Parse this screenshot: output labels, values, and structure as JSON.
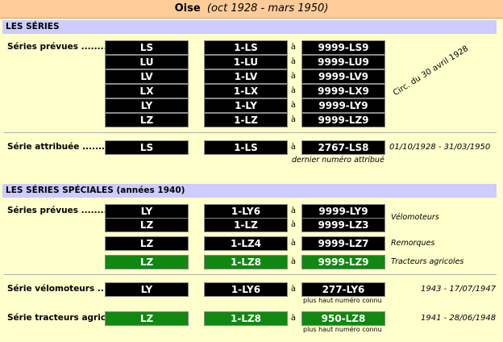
{
  "header": {
    "dept": "Oise",
    "period": "(oct 1928 - mars 1950)"
  },
  "sections": {
    "series": "LES SÉRIES",
    "speciales": "LES SÉRIES SPÉCIALES (années 1940)"
  },
  "labels": {
    "prevues1": "Séries prévues .........",
    "attribuee": "Série attribuée ........",
    "prevues2": "Séries prévues .........",
    "velomoteurs": "Série vélomoteurs ....",
    "tracteurs": "Série tracteurs agric."
  },
  "a": "à",
  "circ": "Circ. du 30 avril 1928",
  "series_prevues": [
    {
      "serie": "LS",
      "from": "1-LS",
      "to": "9999-LS9"
    },
    {
      "serie": "LU",
      "from": "1-LU",
      "to": "9999-LU9"
    },
    {
      "serie": "LV",
      "from": "1-LV",
      "to": "9999-LV9"
    },
    {
      "serie": "LX",
      "from": "1-LX",
      "to": "9999-LX9"
    },
    {
      "serie": "LY",
      "from": "1-LY",
      "to": "9999-LY9"
    },
    {
      "serie": "LZ",
      "from": "1-LZ",
      "to": "9999-LZ9"
    }
  ],
  "attribuee": {
    "serie": "LS",
    "from": "1-LS",
    "to": "2767-LS8",
    "dates": "01/10/1928 - 31/03/1950",
    "note": "dernier numéro attribué"
  },
  "speciales": [
    {
      "serie": "LY",
      "from": "1-LY6",
      "to": "9999-LY9"
    },
    {
      "serie": "LZ",
      "from": "1-LZ",
      "to": "9999-LZ3"
    },
    {
      "serie": "LZ",
      "from": "1-LZ4",
      "to": "9999-LZ7"
    },
    {
      "serie": "LZ",
      "from": "1-LZ8",
      "to": "9999-LZ9"
    }
  ],
  "speciales_notes": {
    "velo": "Vélomoteurs",
    "remorques": "Remorques",
    "tracteurs": "Tracteurs agricoles"
  },
  "velomoteurs": {
    "serie": "LY",
    "from": "1-LY6",
    "to": "277-LY6",
    "note": "plus haut numéro connu",
    "dates": "1943 - 17/07/1947"
  },
  "tracteurs": {
    "serie": "LZ",
    "from": "1-LZ8",
    "to": "950-LZ8",
    "note": "plus haut numéro connu",
    "dates": "1941 - 28/06/1948"
  },
  "colors": {
    "black_plate": "#000000",
    "green_plate": "#118811",
    "background": "#ffffcc",
    "header": "#ffcc99",
    "section": "#ccccff"
  }
}
